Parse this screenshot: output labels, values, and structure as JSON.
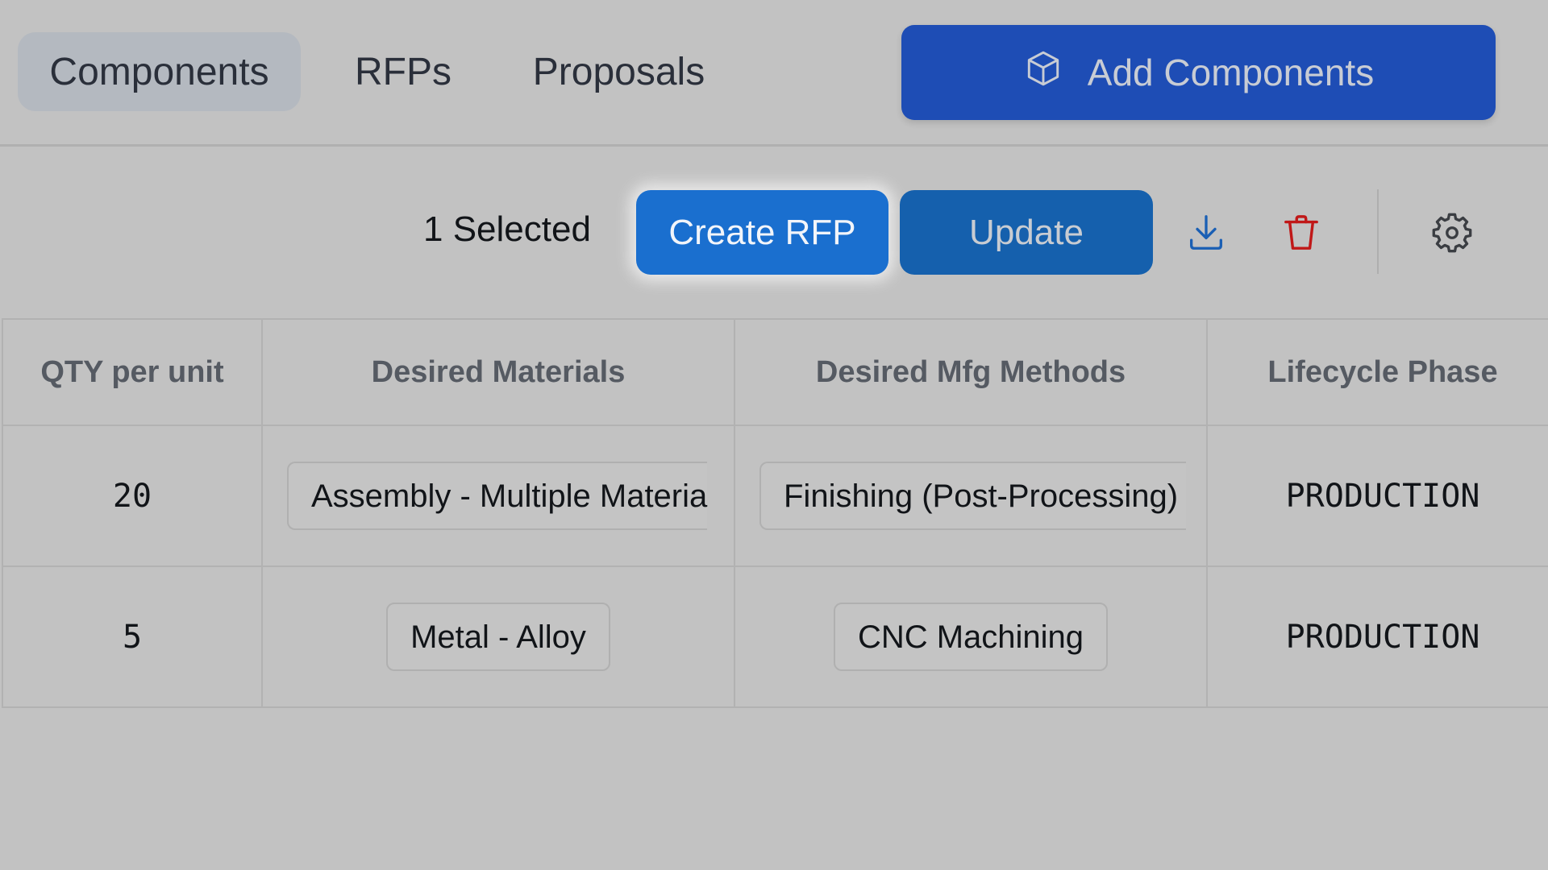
{
  "tabs": [
    {
      "label": "Components",
      "active": true
    },
    {
      "label": "RFPs",
      "active": false
    },
    {
      "label": "Proposals",
      "active": false
    }
  ],
  "add_button": {
    "label": "Add Components",
    "icon": "cube-icon"
  },
  "toolbar": {
    "selected_count": "1 Selected",
    "create_rfp_label": "Create RFP",
    "update_label": "Update",
    "icons": [
      "download-icon",
      "trash-icon",
      "gear-icon"
    ]
  },
  "table": {
    "columns": [
      "QTY per unit",
      "Desired Materials",
      "Desired Mfg Methods",
      "Lifecycle Phase"
    ],
    "rows": [
      {
        "qty": "20",
        "material": "Assembly - Multiple Materia",
        "method": "Finishing (Post-Processing)",
        "phase": "PRODUCTION"
      },
      {
        "qty": "5",
        "material": "Metal - Alloy",
        "method": "CNC Machining",
        "phase": "PRODUCTION"
      }
    ]
  },
  "colors": {
    "background": "#c2c2c2",
    "add_button": "#1e4db5",
    "create_rfp": "#1a6fcf",
    "update": "#1560ad",
    "download_icon": "#1a5fb4",
    "trash_icon": "#c01818",
    "gear_icon": "#3a3d42"
  }
}
